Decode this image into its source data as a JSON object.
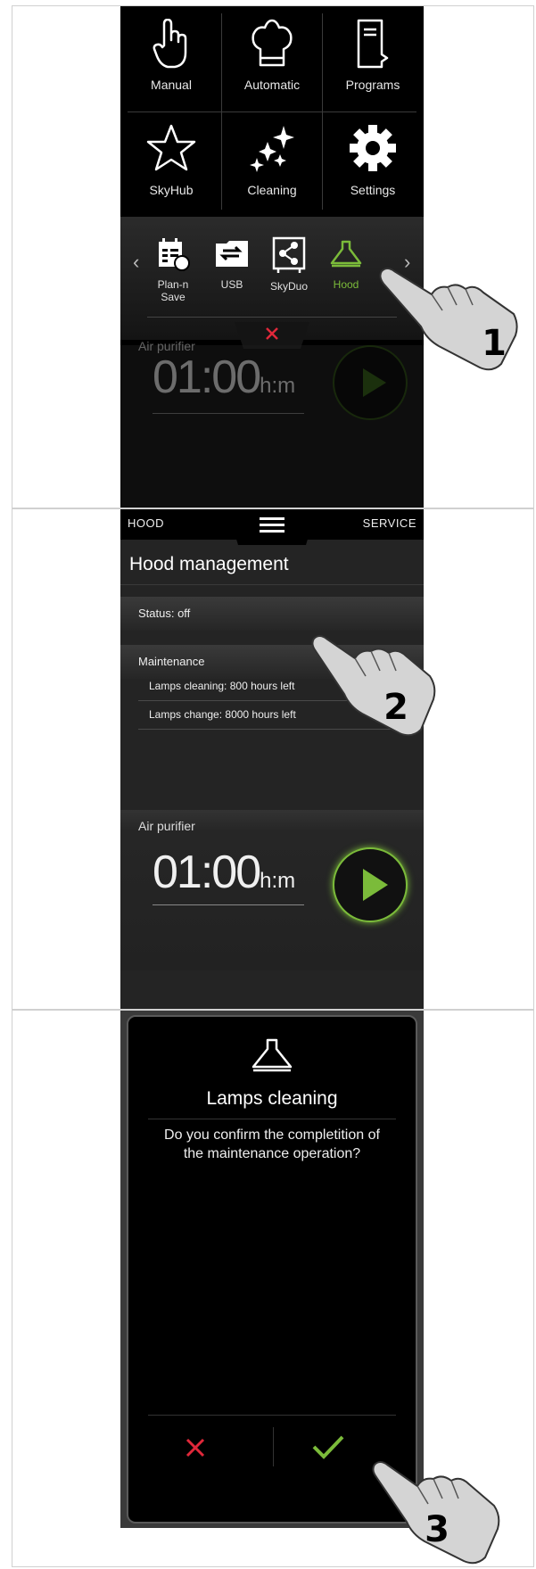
{
  "colors": {
    "accent_green": "#7bbb3a",
    "danger_red": "#e0283a",
    "screen_bg": "#000000",
    "panel_bg": "#242424"
  },
  "screen1": {
    "main_menu": [
      {
        "label": "Manual",
        "icon": "hand-pointer-icon"
      },
      {
        "label": "Automatic",
        "icon": "chef-hat-icon"
      },
      {
        "label": "Programs",
        "icon": "book-icon"
      },
      {
        "label": "SkyHub",
        "icon": "star-icon"
      },
      {
        "label": "Cleaning",
        "icon": "sparkle-icon"
      },
      {
        "label": "Settings",
        "icon": "gear-icon"
      }
    ],
    "sub_menu": [
      {
        "label": "Plan-n Save",
        "icon": "planner-icon"
      },
      {
        "label": "USB",
        "icon": "usb-transfer-icon"
      },
      {
        "label": "SkyDuo",
        "icon": "share-icon"
      },
      {
        "label": "Hood",
        "icon": "hood-icon",
        "active": true
      }
    ],
    "purifier": {
      "title": "Air purifier",
      "time": "01:00",
      "unit": "h:m"
    },
    "step": "1"
  },
  "screen2": {
    "topbar": {
      "left": "HOOD",
      "right": "SERVICE"
    },
    "title": "Hood management",
    "status": "Status: off",
    "maintenance_title": "Maintenance",
    "maintenance_items": [
      "Lamps cleaning: 800 hours left",
      "Lamps change: 8000 hours left"
    ],
    "purifier": {
      "title": "Air purifier",
      "time": "01:00",
      "unit": "h:m"
    },
    "step": "2"
  },
  "screen3": {
    "dialog_title": "Lamps cleaning",
    "dialog_line1": "Do you confirm the completition of",
    "dialog_line2": "the maintenance operation?",
    "step": "3"
  }
}
